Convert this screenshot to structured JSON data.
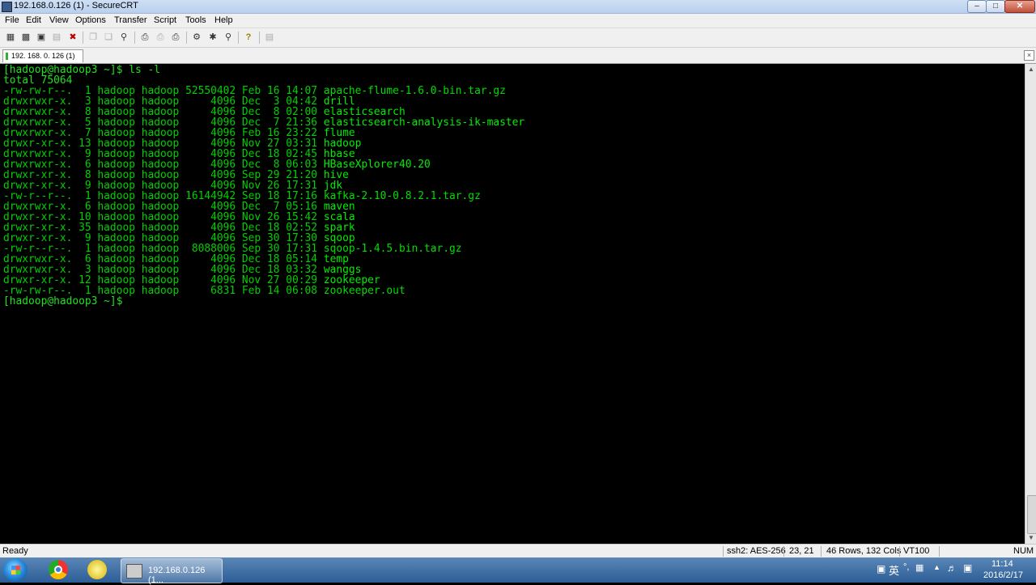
{
  "window": {
    "title": "192.168.0.126 (1) - SecureCRT"
  },
  "menu": [
    "File",
    "Edit",
    "View",
    "Options",
    "Transfer",
    "Script",
    "Tools",
    "Help"
  ],
  "toolbar": {
    "icons": [
      "connect-icon",
      "quick-connect-icon",
      "connect-tab-icon",
      "reconnect-icon",
      "disconnect-icon",
      "copy-icon",
      "paste-icon",
      "find-icon",
      "print-icon",
      "print-selection-icon",
      "printer-setup-icon",
      "session-options-icon",
      "global-options-icon",
      "keymap-icon",
      "help-icon",
      "window-icon"
    ]
  },
  "tab": {
    "label": "192. 168. 0. 126  (1)"
  },
  "terminal": {
    "prompt_cmd": "[hadoop@hadoop3 ~]$ ls -l",
    "total": "total 75064",
    "rows": [
      {
        "meta": "-rw-rw-r--.  1 hadoop hadoop 52550402 Feb 16 14:07 ",
        "name": "apache-flume-1.6.0-bin.tar.gz",
        "dir": false
      },
      {
        "meta": "drwxrwxr-x.  3 hadoop hadoop     4096 Dec  3 04:42 ",
        "name": "drill",
        "dir": true
      },
      {
        "meta": "drwxrwxr-x.  8 hadoop hadoop     4096 Dec  8 02:00 ",
        "name": "elasticsearch",
        "dir": true
      },
      {
        "meta": "drwxrwxr-x.  5 hadoop hadoop     4096 Dec  7 21:36 ",
        "name": "elasticsearch-analysis-ik-master",
        "dir": true
      },
      {
        "meta": "drwxrwxr-x.  7 hadoop hadoop     4096 Feb 16 23:22 ",
        "name": "flume",
        "dir": true
      },
      {
        "meta": "drwxr-xr-x. 13 hadoop hadoop     4096 Nov 27 03:31 ",
        "name": "hadoop",
        "dir": true
      },
      {
        "meta": "drwxrwxr-x.  9 hadoop hadoop     4096 Dec 18 02:45 ",
        "name": "hbase",
        "dir": true
      },
      {
        "meta": "drwxrwxr-x.  6 hadoop hadoop     4096 Dec  8 06:03 ",
        "name": "HBaseXplorer40.20",
        "dir": true
      },
      {
        "meta": "drwxr-xr-x.  8 hadoop hadoop     4096 Sep 29 21:20 ",
        "name": "hive",
        "dir": true
      },
      {
        "meta": "drwxr-xr-x.  9 hadoop hadoop     4096 Nov 26 17:31 ",
        "name": "jdk",
        "dir": true
      },
      {
        "meta": "-rw-r--r--.  1 hadoop hadoop 16144942 Sep 18 17:16 ",
        "name": "kafka-2.10-0.8.2.1.tar.gz",
        "dir": false
      },
      {
        "meta": "drwxrwxr-x.  6 hadoop hadoop     4096 Dec  7 05:16 ",
        "name": "maven",
        "dir": true
      },
      {
        "meta": "drwxr-xr-x. 10 hadoop hadoop     4096 Nov 26 15:42 ",
        "name": "scala",
        "dir": true
      },
      {
        "meta": "drwxr-xr-x. 35 hadoop hadoop     4096 Dec 18 02:52 ",
        "name": "spark",
        "dir": true
      },
      {
        "meta": "drwxr-xr-x.  9 hadoop hadoop     4096 Sep 30 17:30 ",
        "name": "sqoop",
        "dir": true
      },
      {
        "meta": "-rw-r--r--.  1 hadoop hadoop  8088006 Sep 30 17:31 ",
        "name": "sqoop-1.4.5.bin.tar.gz",
        "dir": false
      },
      {
        "meta": "drwxrwxr-x.  6 hadoop hadoop     4096 Dec 18 05:14 ",
        "name": "temp",
        "dir": true
      },
      {
        "meta": "drwxrwxr-x.  3 hadoop hadoop     4096 Dec 18 03:32 ",
        "name": "wanggs",
        "dir": true
      },
      {
        "meta": "drwxr-xr-x. 12 hadoop hadoop     4096 Nov 27 00:29 ",
        "name": "zookeeper",
        "dir": true
      },
      {
        "meta": "-rw-rw-r--.  1 hadoop hadoop     6831 Feb 14 06:08 ",
        "name": "zookeeper.out",
        "dir": false
      }
    ],
    "final_prompt": "[hadoop@hadoop3 ~]$",
    "colors": {
      "text": "#20e020",
      "background": "#000000"
    }
  },
  "status": {
    "ready": "Ready",
    "cipher": "ssh2: AES-256",
    "cursor": "23,  21",
    "size": "46 Rows, 132 Cols",
    "emulation": "VT100",
    "num": "NUM"
  },
  "taskbar": {
    "task_label": "192.168.0.126 (1...",
    "ime": "英",
    "clock_time": "11:14",
    "clock_date": "2016/2/17"
  }
}
